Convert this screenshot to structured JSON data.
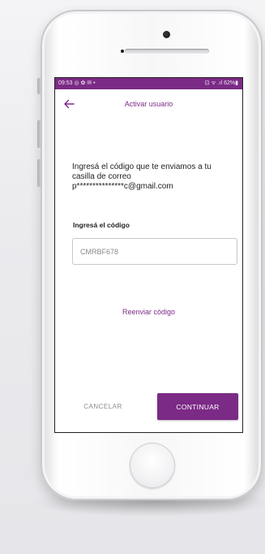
{
  "status_bar": {
    "time_and_icons": "09:53 ◎ ✿ ✉ •",
    "right_indicators": "⊡ ᯤ .ıl 62%▮"
  },
  "app_bar": {
    "back_icon": "arrow-left",
    "title": "Activar usuario"
  },
  "form": {
    "instruction": "Ingresá el código que te enviamos a tu casilla de correo p***************c@gmail.com",
    "code_label": "Ingresá el código",
    "code_value": "CMRBF678",
    "resend_link": "Reenviar código"
  },
  "actions": {
    "cancel_label": "CANCELAR",
    "continue_label": "CONTINUAR"
  },
  "colors": {
    "brand": "#7b2a86",
    "text": "#222222",
    "muted": "#8c8c8c"
  }
}
